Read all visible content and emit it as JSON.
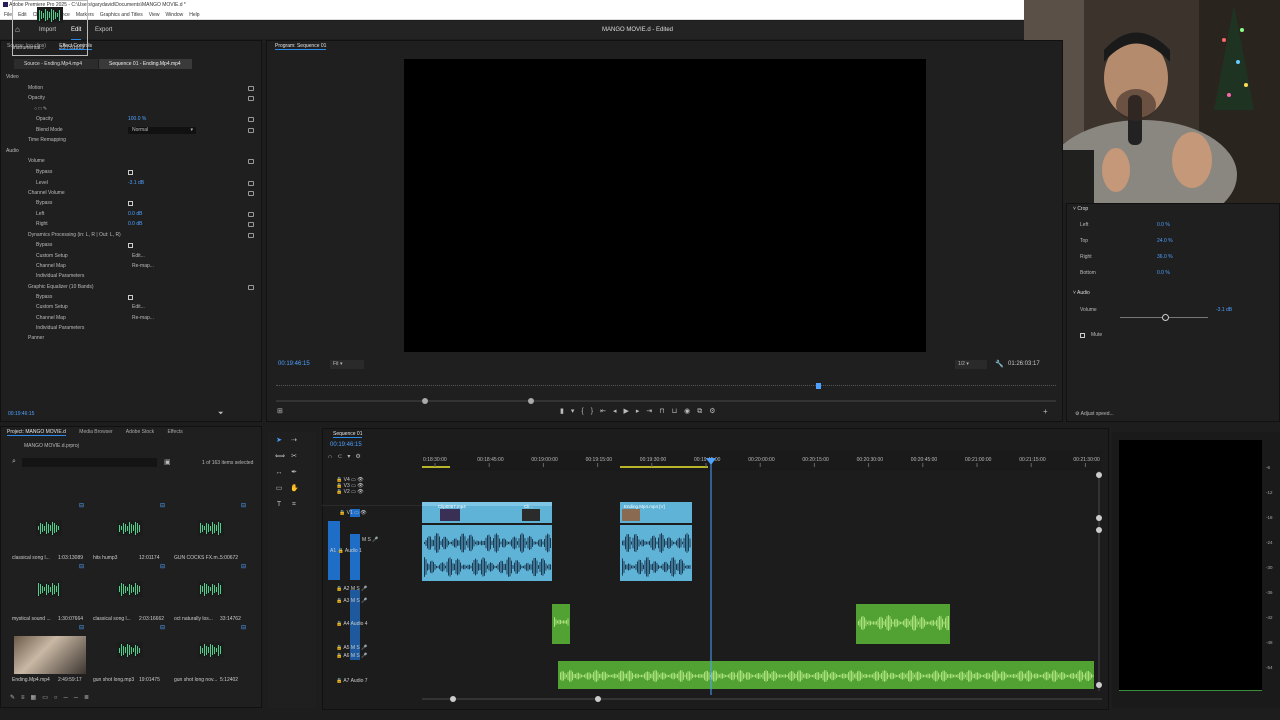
{
  "titlebar": {
    "title": "Adobe Premiere Pro 2025 - C:\\Users\\garydavid\\Documents\\MANGO MOVIE.d *"
  },
  "menu": [
    "File",
    "Edit",
    "Clip",
    "Sequence",
    "Markers",
    "Graphics and Titles",
    "View",
    "Window",
    "Help"
  ],
  "appbar": {
    "home": "home",
    "import": "Import",
    "edit": "Edit",
    "export": "Export",
    "project": "MANGO MOVIE.d - Edited"
  },
  "effectControls": {
    "tabs": [
      "Source: (no clips)",
      "Effect Controls"
    ],
    "source": "Source - Ending.Mp4.mp4",
    "sequence": "Sequence 01 - Ending.Mp4.mp4",
    "video": "Video",
    "motion": "Motion",
    "opacity": "Opacity",
    "opacity_val": "100.0 %",
    "blend": "Blend Mode",
    "blend_val": "Normal",
    "time_remap": "Time Remapping",
    "audio": "Audio",
    "volume": "Volume",
    "bypass": "Bypass",
    "level": "Level",
    "level_val": "-3.1 dB",
    "channel_volume": "Channel Volume",
    "left": "Left",
    "left_val": "0.0 dB",
    "right": "Right",
    "right_val": "0.0 dB",
    "dyn": "Dynamics Processing (in: L, R | Out: L, R)",
    "custom_setup": "Custom Setup",
    "edit": "Edit...",
    "channel_map": "Channel Map",
    "remap": "Re-map...",
    "individual": "Individual Parameters",
    "geq": "Graphic Equalizer (10 Bands)",
    "panner": "Panner",
    "timecode": "00:19:46:15"
  },
  "program": {
    "tab": "Program: Sequence 01",
    "timecode": "00:19:46:15",
    "fit": "Fit",
    "quality": "1/2",
    "duration": "01:26:03:17"
  },
  "rightPanel": {
    "crop": "Crop",
    "left": "Left",
    "left_val": "0.0 %",
    "top": "Top",
    "top_val": "24.0 %",
    "right": "Right",
    "right_val": "36.0 %",
    "bottom": "Bottom",
    "bottom_val": "0.0 %",
    "audio": "Audio",
    "volume": "Volume",
    "vol_val": "-3.1 dB",
    "mute": "Mute",
    "adjust": "Adjust speed..."
  },
  "project": {
    "tabs": [
      "Project: MANGO MOVIE.d",
      "Media Browser",
      "Adobe Stock",
      "Effects"
    ],
    "file": "MANGO MOVIE.d.prproj",
    "count": "1 of 163 items selected",
    "items": [
      {
        "name": "classical song l...",
        "dur": "1:03:13089"
      },
      {
        "name": "hits hump3",
        "dur": "12:01174"
      },
      {
        "name": "GUN COCKS FX.m...",
        "dur": "5:00672"
      },
      {
        "name": "mystical sound ...",
        "dur": "1:30:07664"
      },
      {
        "name": "classical song l...",
        "dur": "2:03:16662"
      },
      {
        "name": "oct naturally los...",
        "dur": "33:14762"
      },
      {
        "name": "Ending.Mp4.mp4",
        "dur": "2:49:59:17"
      },
      {
        "name": "gun shot long.mp3",
        "dur": "19:01475"
      },
      {
        "name": "gun shot long nov...",
        "dur": "5:12402"
      },
      {
        "name": "instrumental...",
        "dur": "3:27:01919"
      }
    ]
  },
  "timeline": {
    "tab": "Sequence 01",
    "timecode": "00:19:46:15",
    "ruler": [
      "0:18:30:00",
      "00:18:45:00",
      "00:19:00:00",
      "00:19:15:00",
      "00:19:30:00",
      "00:19:45:00",
      "00:20:00:00",
      "00:20:15:00",
      "00:20:30:00",
      "00:20:45:00",
      "00:21:00:00",
      "00:21:15:00",
      "00:21:30:00"
    ],
    "tracks": {
      "v4": "V4",
      "v3": "V3",
      "v2": "V2",
      "v1": "V1",
      "a1": "A1",
      "audio1": "Audio 1",
      "a2": "A2",
      "a3": "A3",
      "a4": "A4",
      "audio4": "Audio 4",
      "a5": "A5",
      "a6": "A6",
      "a7": "A7",
      "audio7": "Audio 7"
    },
    "clips": {
      "c1": "Clip0067.mp4",
      "c2": "Cli...",
      "c3": "Ending.Mp4.mp4 [V]"
    },
    "meter": [
      "-6",
      "-12",
      "-18",
      "-24",
      "-30",
      "-36",
      "-42",
      "-48",
      "-54"
    ]
  }
}
